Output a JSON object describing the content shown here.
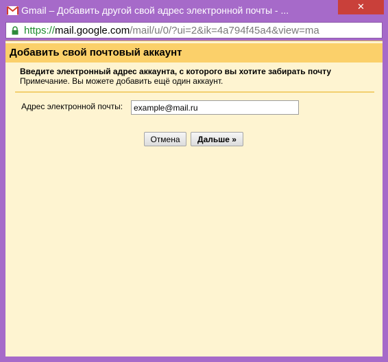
{
  "window": {
    "title": "Gmail – Добавить другой свой адрес электронной почты - ...",
    "app_icon": "gmail-icon",
    "close_icon": "close-icon",
    "close_glyph": "✕"
  },
  "addressbar": {
    "lock_icon": "lock-icon",
    "scheme": "https://",
    "host": "mail.google.com",
    "path": "/mail/u/0/?ui=2&ik=4a794f45a4&view=ma"
  },
  "dialog": {
    "title": "Добавить свой почтовый аккаунт",
    "instruction": "Введите электронный адрес аккаунта, с которого вы хотите забирать почту",
    "note": "Примечание. Вы можете добавить ещё один аккаунт.",
    "email_label": "Адрес электронной почты:",
    "email_value": "example@mail.ru",
    "cancel_label": "Отмена",
    "next_label": "Дальше »"
  },
  "colors": {
    "window_frame": "#a66ac9",
    "header_bar": "#fbd06a",
    "content_bg": "#fef4d1",
    "close_button": "#c9403a",
    "https_green": "#1c8b2e"
  }
}
